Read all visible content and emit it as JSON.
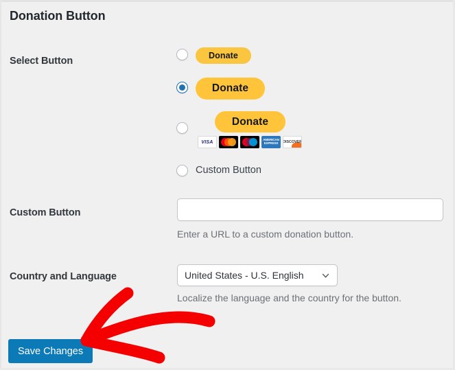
{
  "page": {
    "title": "Donation Button",
    "background_color": "#f0f0f0"
  },
  "rows": {
    "select_button": {
      "label": "Select Button",
      "options": [
        {
          "id": "donate-small",
          "selected": false,
          "button_text": "Donate",
          "style": "small-gold",
          "color": "#fbc63f"
        },
        {
          "id": "donate-large",
          "selected": true,
          "button_text": "Donate",
          "style": "large-gold",
          "color": "#ffc439"
        },
        {
          "id": "donate-cards",
          "selected": false,
          "button_text": "Donate",
          "style": "large-gold-with-cards",
          "color": "#ffc439"
        },
        {
          "id": "custom",
          "selected": false,
          "label": "Custom Button"
        }
      ],
      "card_logos": [
        {
          "name": "visa-card-icon",
          "text": "VISA"
        },
        {
          "name": "mastercard-card-icon",
          "text": ""
        },
        {
          "name": "maestro-card-icon",
          "text": ""
        },
        {
          "name": "amex-card-icon",
          "text": "AMERICAN EXPRESS"
        },
        {
          "name": "discover-card-icon",
          "text": "DISCOVER"
        }
      ]
    },
    "custom_button": {
      "label": "Custom Button",
      "input_value": "",
      "input_placeholder": "",
      "help_text": "Enter a URL to a custom donation button."
    },
    "country_language": {
      "label": "Country and Language",
      "selected_value": "United States - U.S. English",
      "help_text": "Localize the language and the country for the button."
    }
  },
  "footer": {
    "save_label": "Save Changes",
    "save_color": "#0d7ab8"
  },
  "annotation": {
    "arrow_color": "#f40000",
    "points_at": "Save Changes"
  }
}
